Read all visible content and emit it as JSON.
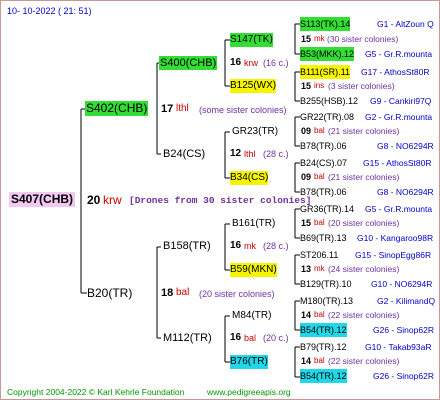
{
  "header": {
    "date": "10- 10-2022 ( 21: 51)"
  },
  "footer": {
    "copyright": "Copyright 2004-2022 © Karl Kehrle Foundation",
    "site": "www.pedigreeapis.org"
  },
  "root": {
    "id": "S407(CHB)",
    "num": "20",
    "code": "krw",
    "note": "[Drones from 30 sister colonies]"
  },
  "gen1": [
    {
      "id": "S402(CHB)",
      "num": "17",
      "code": "lthl",
      "note": "(some sister colonies)"
    },
    {
      "id": "B20(TR)",
      "num": "18",
      "code": "bal",
      "note": "(20 sister colonies)"
    }
  ],
  "gen2": [
    {
      "id": "S400(CHB)",
      "num": "16",
      "code": "krw",
      "note": "(16 c.)"
    },
    {
      "id": "B24(CS)",
      "num": "12",
      "code": "lthl",
      "note": "(28 c.)"
    },
    {
      "id": "B158(TR)",
      "num": "16",
      "code": "mk",
      "note": "(28 c.)"
    },
    {
      "id": "M112(TR)",
      "num": "16",
      "code": "bal",
      "note": "(20 c.)"
    }
  ],
  "gen3": [
    {
      "id": "S147(TK)"
    },
    {
      "id": "B125(WX)"
    },
    {
      "id": "GR23(TR)"
    },
    {
      "id": "B34(CS)"
    },
    {
      "id": "B161(TR)"
    },
    {
      "id": "B59(MKN)"
    },
    {
      "id": "M84(TR)"
    },
    {
      "id": "B76(TR)"
    }
  ],
  "gen4": [
    {
      "id": "S113(TK).14",
      "ref": "G1 - AltZoun Q"
    },
    {
      "num": "15",
      "code": "mk",
      "note": "(30 sister colonies)"
    },
    {
      "id": "B53(MKK).12",
      "ref": "G5 - Gr.R.mounta"
    },
    {
      "id": "B111(SR).11",
      "ref": "G17 - AthosSt80R"
    },
    {
      "num": "15",
      "code": "ins",
      "note": "(3 sister colonies)"
    },
    {
      "id": "B255(HSB).12",
      "ref": "G9 - Cankiri97Q"
    },
    {
      "id": "GR22(TR).08",
      "ref": "G2 - Gr.R.mounta"
    },
    {
      "num": "09",
      "code": "bal",
      "note": "(21 sister colonies)"
    },
    {
      "id": "B78(TR).06",
      "ref": "G8 - NO6294R"
    },
    {
      "id": "B24(CS).07",
      "ref": "G15 - AthosSt80R"
    },
    {
      "num": "09",
      "code": "bal",
      "note": "(21 sister colonies)"
    },
    {
      "id": "B78(TR).06",
      "ref": "G8 - NO6294R"
    },
    {
      "id": "GR36(TR).14",
      "ref": "G5 - Gr.R.mounta"
    },
    {
      "num": "15",
      "code": "bal",
      "note": "(20 sister colonies)"
    },
    {
      "id": "B69(TR).13",
      "ref": "G10 - Kangaroo98R"
    },
    {
      "id": "ST206.11",
      "ref": "G15 - SinopEgg86R"
    },
    {
      "num": "13",
      "code": "mk",
      "note": "(24 sister colonies)"
    },
    {
      "id": "B129(TR).10",
      "ref": "G10 - NO6294R"
    },
    {
      "id": "M180(TR).13",
      "ref": "G2 - KilimandQ"
    },
    {
      "num": "14",
      "code": "bal",
      "note": "(22 sister colonies)"
    },
    {
      "id": "B54(TR).12",
      "ref": "G26 - Sinop62R"
    },
    {
      "id": "B79(TR).12",
      "ref": "G10 - Takab93aR"
    },
    {
      "num": "14",
      "code": "bal",
      "note": "(22 sister colonies)"
    },
    {
      "id": "B54(TR).12",
      "ref": "G26 - Sinop62R"
    }
  ],
  "colors": {
    "green": "#33dd33",
    "yellow": "#f5f500",
    "cyan": "#22d8e8",
    "pink": "#f3c8f3",
    "red": "#cc0000",
    "purple": "#7030a0",
    "blue": "#0000cc",
    "footer": "#009900"
  }
}
